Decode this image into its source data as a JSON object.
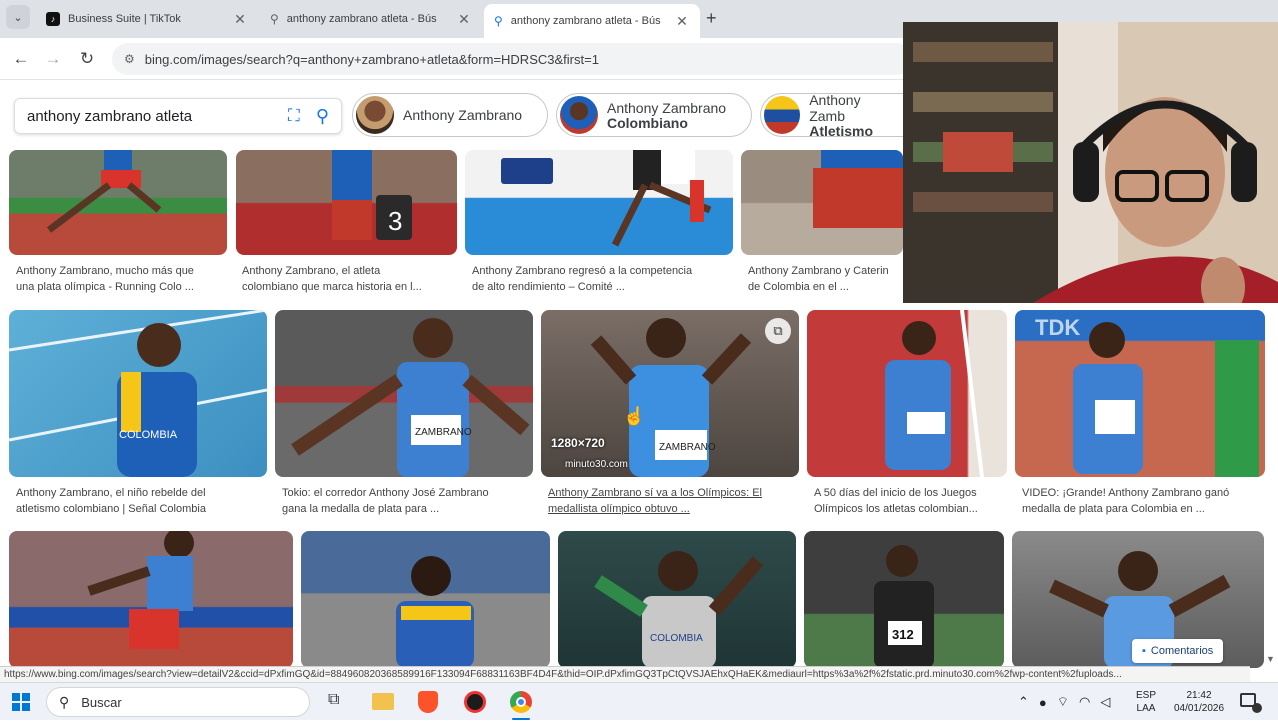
{
  "browser": {
    "tabs": [
      {
        "title": "Business Suite | TikTok",
        "active": false
      },
      {
        "title": "anthony zambrano atleta - Bús",
        "active": false
      },
      {
        "title": "anthony zambrano atleta - Bús",
        "active": true
      }
    ],
    "new_tab_label": "+",
    "url": "bing.com/images/search?q=anthony+zambrano+atleta&form=HDRSC3&first=1"
  },
  "search": {
    "query": "anthony zambrano atleta",
    "chips": [
      {
        "line1": "Anthony Zambrano",
        "line2": ""
      },
      {
        "line1": "Anthony Zambrano",
        "line2": "Colombiano"
      },
      {
        "line1": "Anthony Zamb",
        "line2": "Atletismo"
      }
    ]
  },
  "results": {
    "row1_captions": [
      [
        "Anthony Zambrano, mucho más que",
        "una plata olímpica - Running Colo ..."
      ],
      [
        "Anthony Zambrano, el atleta",
        "colombiano que marca historia en l..."
      ],
      [
        "Anthony Zambrano regresó a la competencia",
        "de alto rendimiento – Comité ..."
      ],
      [
        "Anthony Zambrano y Caterin",
        "de Colombia en el ..."
      ]
    ],
    "row2_captions": [
      [
        "Anthony Zambrano, el niño rebelde del",
        "atletismo colombiano | Señal Colombia"
      ],
      [
        "Tokio: el corredor Anthony José Zambrano",
        "gana la medalla de plata para ..."
      ],
      [
        "Anthony Zambrano sí va a los Olímpicos: El",
        "medallista olímpico obtuvo ..."
      ],
      [
        "A 50 días del inicio de los Juegos",
        "Olímpicos los atletas colombian..."
      ],
      [
        "VIDEO: ¡Grande! Anthony Zambrano ganó",
        "medalla de plata para Colombia en ..."
      ]
    ],
    "hover_size": "1280×720",
    "hover_source": "minuto30.com",
    "bib_numbers": [
      "3",
      "312"
    ],
    "jersey_text": [
      "COLOMBIA",
      "ZAMBRANO",
      "TDK"
    ]
  },
  "comments_button": "Comentarios",
  "status_url": "https://www.bing.com/images/search?view=detailV2&ccid=dPxfimGQ&id=884960820368589916F133094F68831163BF4D4F&thid=OIP.dPxfimGQ3TpCtQVSJAEhxQHaEK&mediaurl=https%3a%2f%2fstatic.prd.minuto30.com%2fwp-content%2fuploads...",
  "taskbar": {
    "search_placeholder": "Buscar",
    "lang_top": "ESP",
    "lang_bottom": "LAA",
    "time": "21:42",
    "date": "04/01/2026"
  },
  "colors": {
    "tab_strip": "#dee1e6",
    "accent_blue": "#1a73e8",
    "track_red": "#b84a3c",
    "track_blue": "#2a8bd6"
  }
}
